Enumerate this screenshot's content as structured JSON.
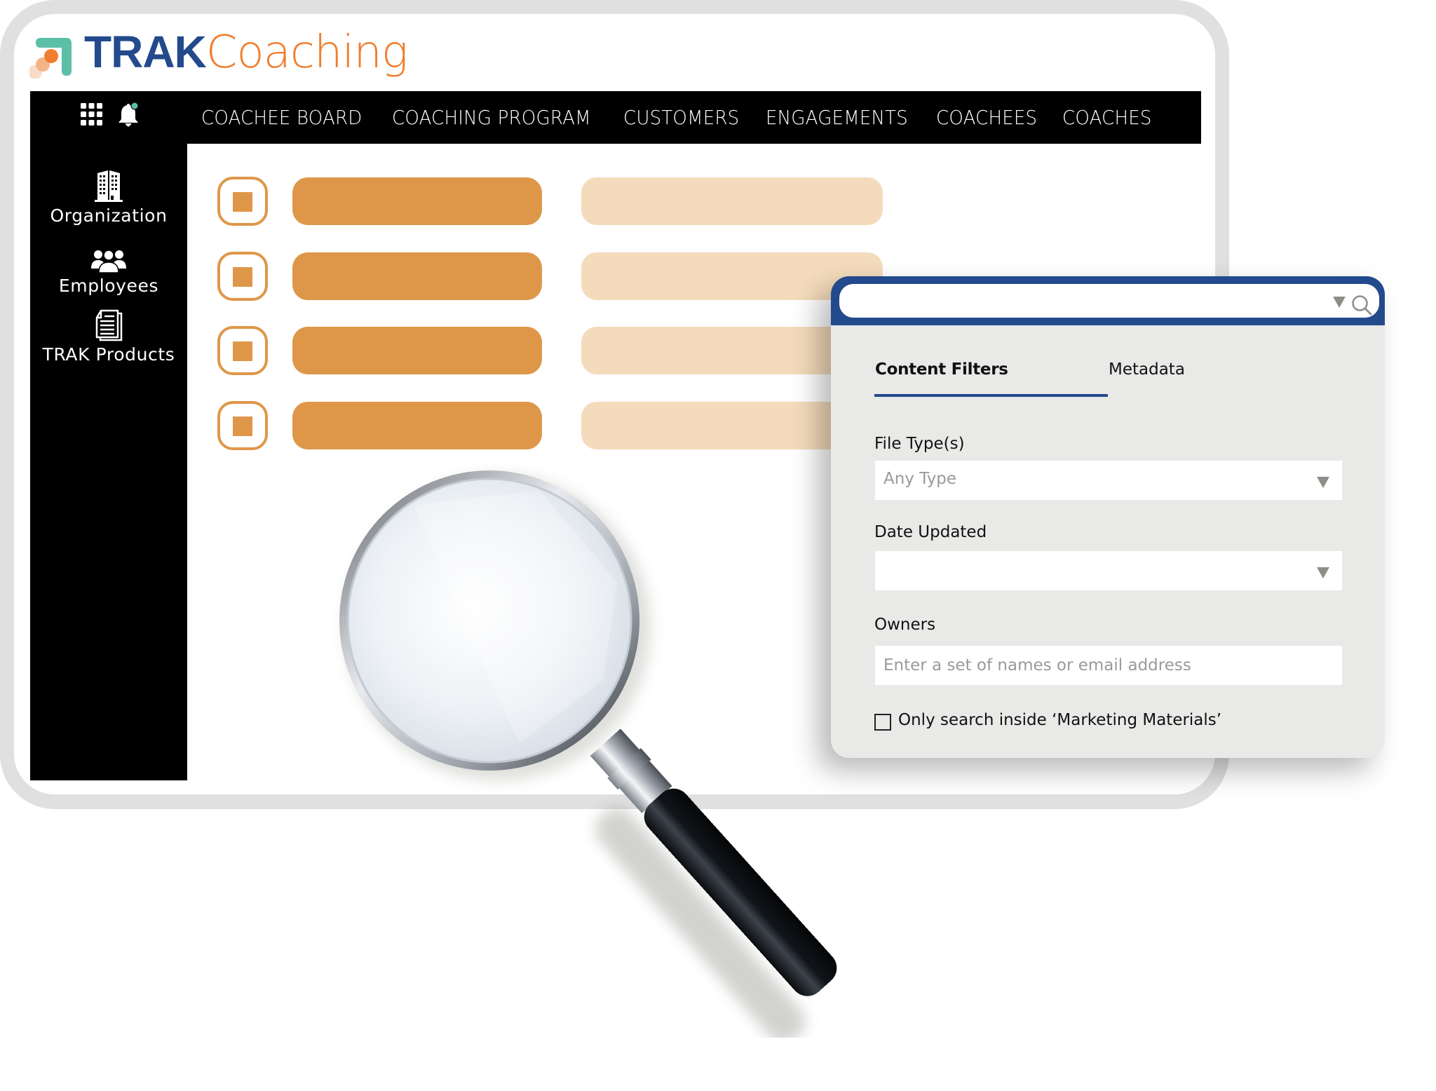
{
  "brand": {
    "name_bold": "TRAK",
    "name_light": "Coaching",
    "colors": {
      "navy": "#234a8c",
      "orange": "#ef7e30",
      "teal": "#5bbfa8",
      "row_dark": "#de9749",
      "row_light": "#f4dbbc",
      "panel_bg": "#e9e9e8"
    }
  },
  "topnav": {
    "icons": [
      "apps-grid-icon",
      "bell-notification-icon"
    ],
    "items": [
      {
        "label": "COACHEE BOARD"
      },
      {
        "label": "COACHING PROGRAM"
      },
      {
        "label": "CUSTOMERS"
      },
      {
        "label": "ENGAGEMENTS"
      },
      {
        "label": "COACHEES"
      },
      {
        "label": "COACHES"
      }
    ]
  },
  "sidebar": {
    "items": [
      {
        "label": "Organization",
        "icon": "building-icon"
      },
      {
        "label": "Employees",
        "icon": "users-group-icon"
      },
      {
        "label": "TRAK Products",
        "icon": "documents-icon"
      }
    ]
  },
  "rows": {
    "count": 4,
    "items": [
      {
        "checked": true
      },
      {
        "checked": true
      },
      {
        "checked": true
      },
      {
        "checked": true
      }
    ]
  },
  "filter_panel": {
    "search": {
      "value": "",
      "placeholder": ""
    },
    "tabs": [
      {
        "label": "Content Filters",
        "active": true
      },
      {
        "label": "Metadata",
        "active": false
      }
    ],
    "file_types": {
      "label": "File Type(s)",
      "value": "Any Type"
    },
    "date_updated": {
      "label": "Date Updated",
      "value": ""
    },
    "owners": {
      "label": "Owners",
      "value": "",
      "placeholder": "Enter a set of names or email address"
    },
    "only_search": {
      "label": "Only search inside ‘Marketing Materials’",
      "checked": false
    }
  }
}
